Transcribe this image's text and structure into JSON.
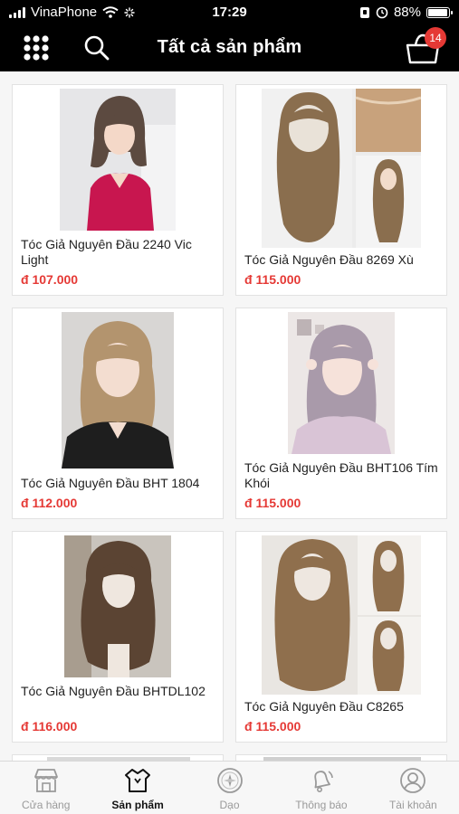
{
  "status_bar": {
    "carrier": "VinaPhone",
    "time": "17:29",
    "battery": "88%",
    "battery_level": 0.88
  },
  "header": {
    "title": "Tất cả sản phẩm",
    "cart_count": "14",
    "menu_icon": "grid-menu-icon",
    "search_icon": "search-icon",
    "cart_icon": "shopping-basket-icon"
  },
  "products": [
    {
      "name": "Tóc Giả Nguyên Đầu 2240 Vic Light",
      "price": "đ 107.000"
    },
    {
      "name": "Tóc Giả Nguyên Đầu 8269 Xù",
      "price": "đ 115.000"
    },
    {
      "name": "Tóc Giả Nguyên Đầu BHT 1804",
      "price": "đ 112.000"
    },
    {
      "name": "Tóc Giả Nguyên Đầu BHT106 Tím Khói",
      "price": "đ 115.000"
    },
    {
      "name": "Tóc Giả Nguyên Đầu BHTDL102",
      "price": "đ 116.000"
    },
    {
      "name": "Tóc Giả Nguyên Đầu C8265",
      "price": "đ 115.000"
    }
  ],
  "tabs": [
    {
      "label": "Cửa hàng",
      "icon": "store-icon",
      "active": false
    },
    {
      "label": "Sản phẩm",
      "icon": "product-tag-icon",
      "active": true
    },
    {
      "label": "Dạo",
      "icon": "compass-icon",
      "active": false
    },
    {
      "label": "Thông báo",
      "icon": "bell-icon",
      "active": false
    },
    {
      "label": "Tài khoản",
      "icon": "user-icon",
      "active": false
    }
  ]
}
